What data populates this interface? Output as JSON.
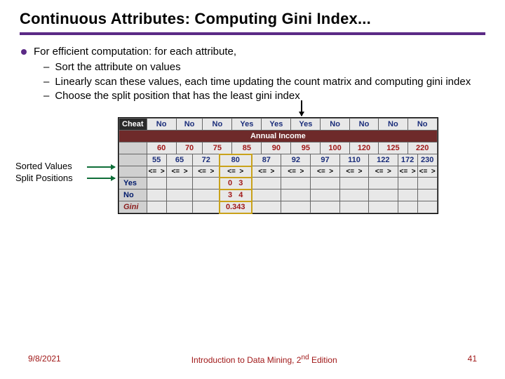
{
  "title": "Continuous Attributes: Computing Gini Index...",
  "bullet_main": "For efficient computation: for each attribute,",
  "subs": [
    "Sort the attribute on values",
    "Linearly scan these values, each time updating the count matrix and computing gini index",
    "Choose the split position that has the least gini index"
  ],
  "left_labels": {
    "a": "Sorted Values",
    "b": "Split Positions"
  },
  "table": {
    "cheat_label": "Cheat",
    "cheat_vals": [
      "No",
      "No",
      "No",
      "Yes",
      "Yes",
      "Yes",
      "No",
      "No",
      "No",
      "No"
    ],
    "income_title": "Annual Income",
    "sorted_vals": [
      "60",
      "70",
      "75",
      "85",
      "90",
      "95",
      "100",
      "120",
      "125",
      "220"
    ],
    "split_pos": [
      "55",
      "65",
      "72",
      "80",
      "87",
      "92",
      "97",
      "110",
      "122",
      "172",
      "230"
    ],
    "ineq": [
      "<=",
      ">"
    ],
    "rows": {
      "yes": {
        "label": "Yes",
        "le": "0",
        "gt": "3"
      },
      "no": {
        "label": "No",
        "le": "3",
        "gt": "4"
      },
      "gini": {
        "label": "Gini",
        "val": "0.343"
      }
    }
  },
  "footer": {
    "date": "9/8/2021",
    "mid_a": "Introduction to Data Mining, 2",
    "mid_sup": "nd",
    "mid_b": " Edition",
    "page": "41"
  }
}
